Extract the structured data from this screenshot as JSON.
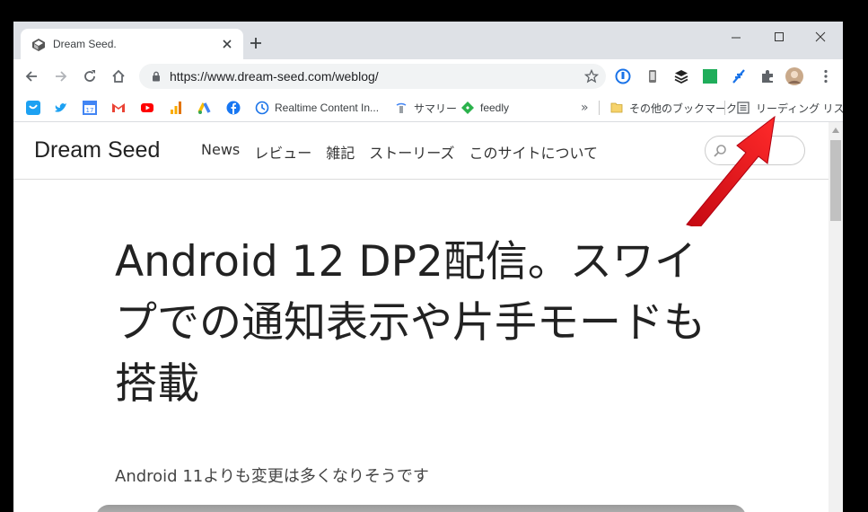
{
  "tab": {
    "title": "Dream Seed."
  },
  "omnibox": {
    "url": "https://www.dream-seed.com/weblog/"
  },
  "bookmarks": {
    "items": [
      {
        "label": ""
      },
      {
        "label": ""
      },
      {
        "label": ""
      },
      {
        "label": ""
      },
      {
        "label": ""
      },
      {
        "label": ""
      },
      {
        "label": ""
      },
      {
        "label": ""
      },
      {
        "label": "Realtime Content In..."
      },
      {
        "label": "サマリー"
      },
      {
        "label": "feedly"
      }
    ],
    "overflow": "»",
    "other": "その他のブックマーク",
    "reading_list": "リーディング リスト"
  },
  "site": {
    "logo": "Dream Seed",
    "nav": [
      "News",
      "レビュー",
      "雑記",
      "ストーリーズ",
      "このサイトについて"
    ]
  },
  "article": {
    "title": "Android 12 DP2配信。スワイプでの通知表示や片手モードも搭載",
    "subtitle": "Android 11よりも変更は多くなりそうです"
  },
  "colors": {
    "annotation_arrow": "#e8111b",
    "chrome_frame": "#dee1e6"
  }
}
